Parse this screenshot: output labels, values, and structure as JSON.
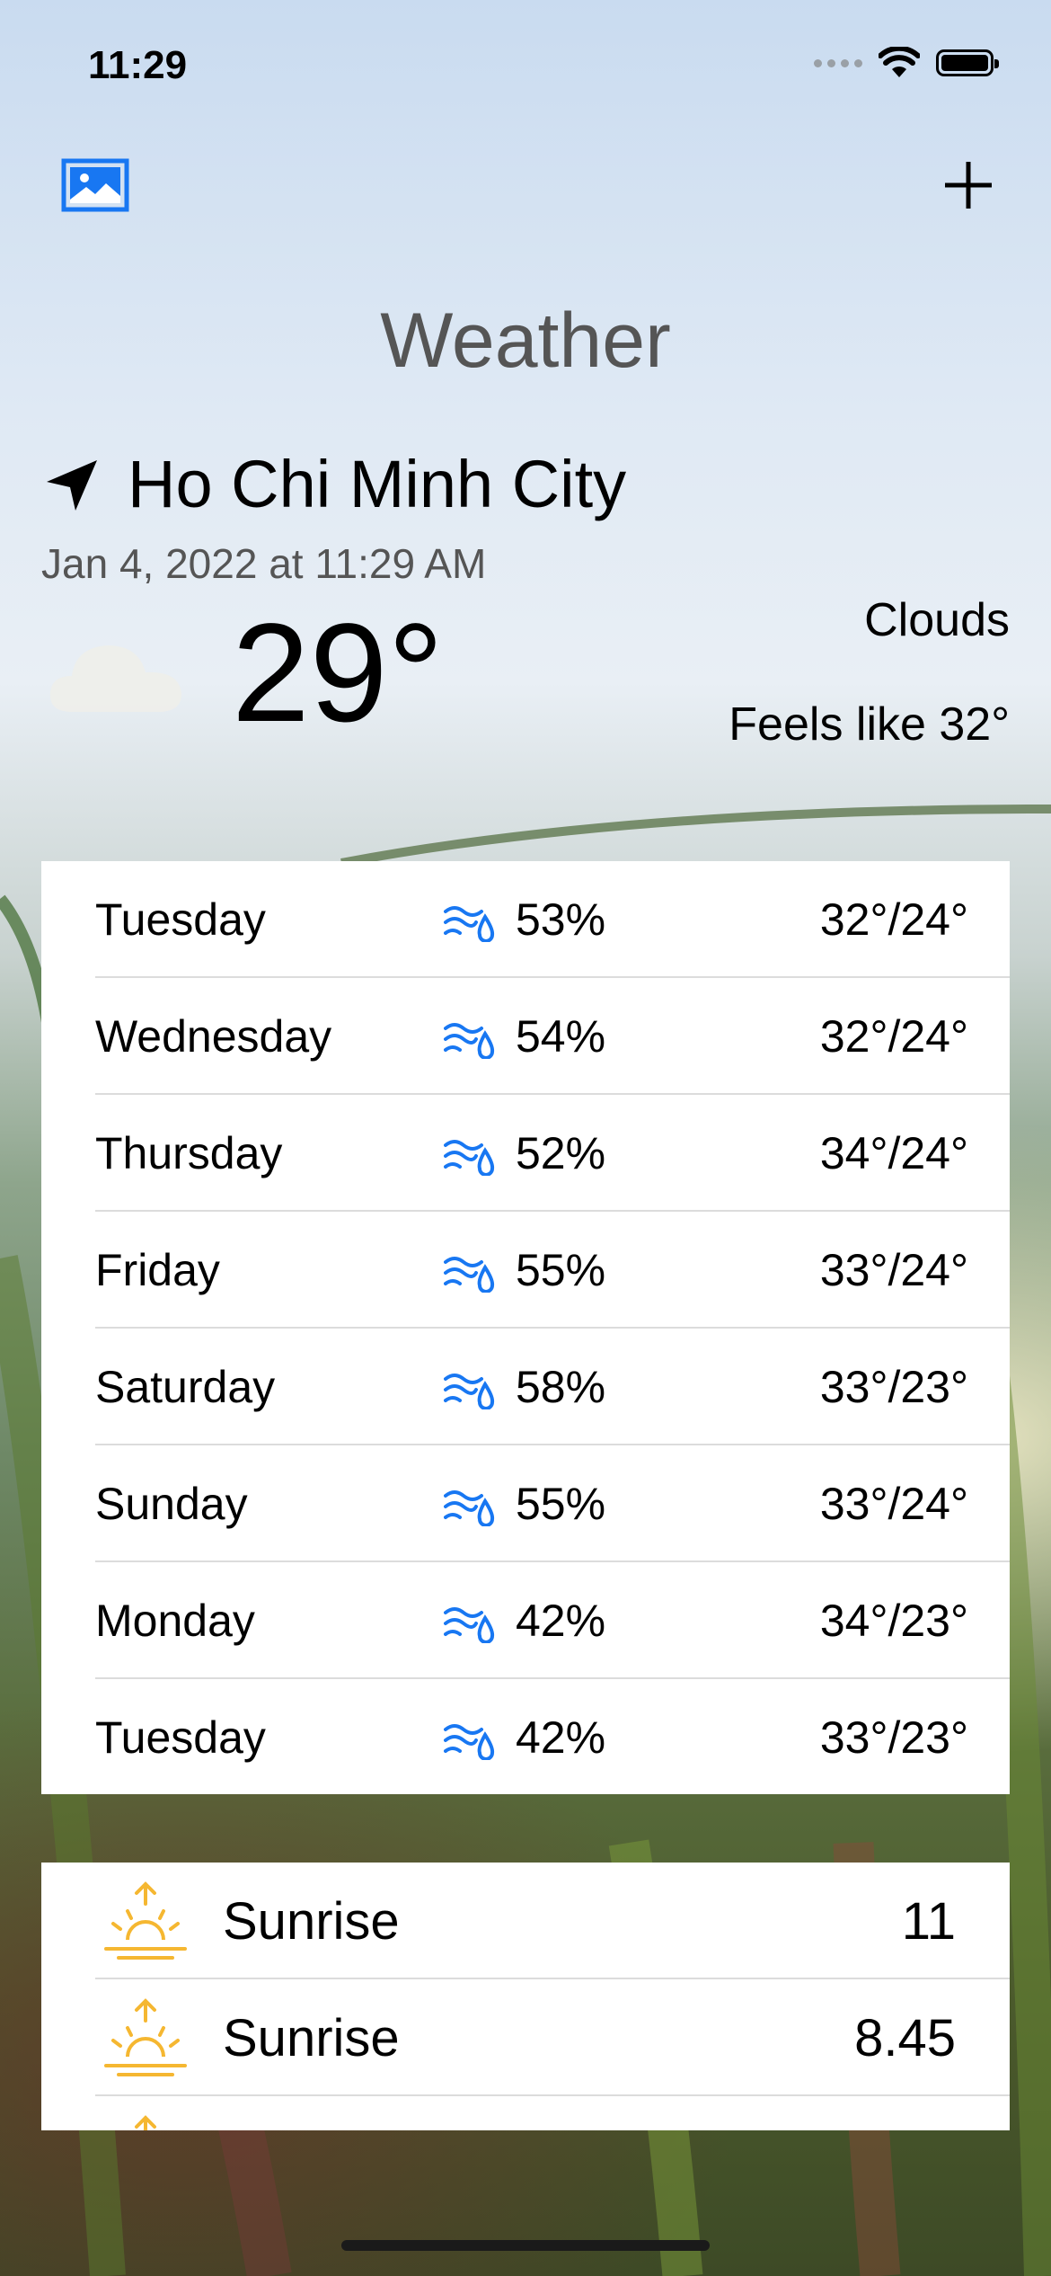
{
  "status_bar": {
    "time": "11:29"
  },
  "header": {
    "photo_icon": "photo-icon",
    "add_icon": "plus-icon",
    "title": "Weather"
  },
  "current": {
    "location_icon": "location-arrow-icon",
    "city": "Ho Chi Minh City",
    "datetime": "Jan 4, 2022 at 11:29 AM",
    "weather_icon": "cloud-icon",
    "temperature": "29°",
    "condition": "Clouds",
    "feels_like": "Feels like 32°"
  },
  "forecast": [
    {
      "day": "Tuesday",
      "humidity": "53%",
      "range": "32°/24°"
    },
    {
      "day": "Wednesday",
      "humidity": "54%",
      "range": "32°/24°"
    },
    {
      "day": "Thursday",
      "humidity": "52%",
      "range": "34°/24°"
    },
    {
      "day": "Friday",
      "humidity": "55%",
      "range": "33°/24°"
    },
    {
      "day": "Saturday",
      "humidity": "58%",
      "range": "33°/23°"
    },
    {
      "day": "Sunday",
      "humidity": "55%",
      "range": "33°/24°"
    },
    {
      "day": "Monday",
      "humidity": "42%",
      "range": "34°/23°"
    },
    {
      "day": "Tuesday",
      "humidity": "42%",
      "range": "33°/23°"
    }
  ],
  "sun": [
    {
      "label": "Sunrise",
      "value": "11"
    },
    {
      "label": "Sunrise",
      "value": "8.45"
    }
  ],
  "colors": {
    "accent": "#1877f2",
    "sun": "#f5b731"
  }
}
